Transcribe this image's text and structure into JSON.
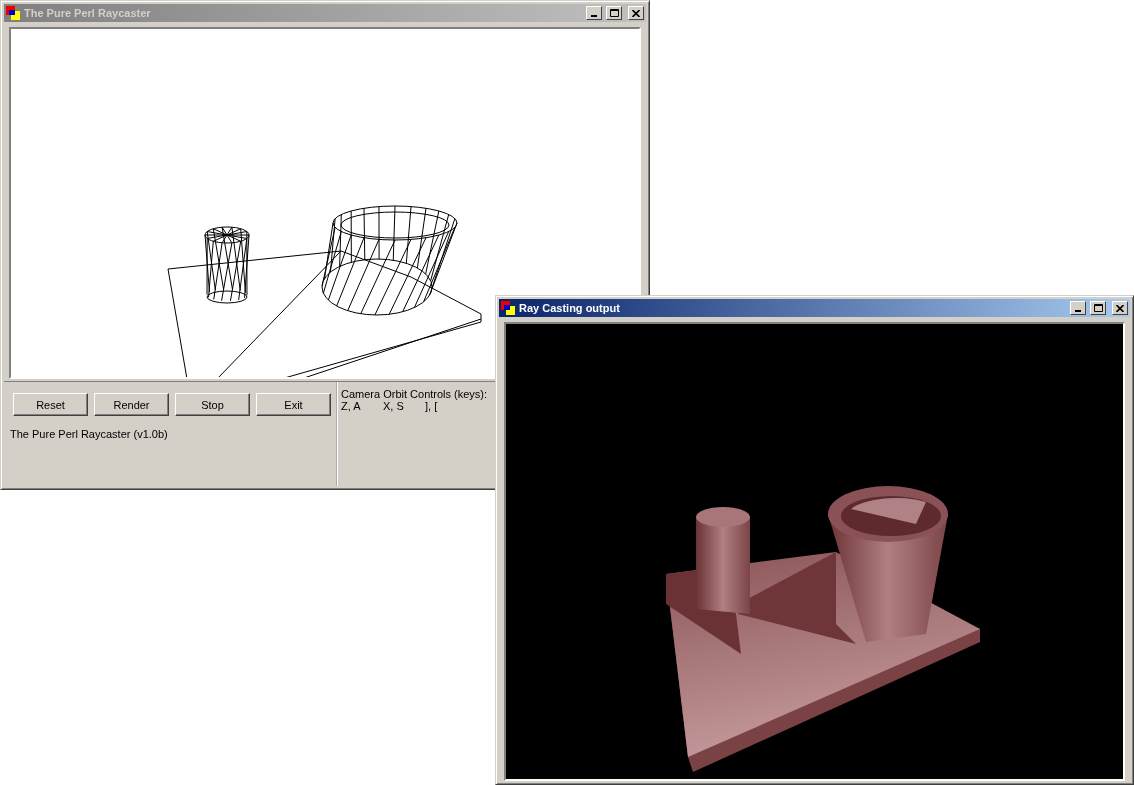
{
  "windows": [
    {
      "title": "The Pure Perl Raycaster",
      "active": false,
      "kind": "editor",
      "buttons": [
        "Reset",
        "Render",
        "Stop",
        "Exit"
      ],
      "status": "The Pure Perl Raycaster (v1.0b)",
      "controls_heading": "Camera Orbit Controls (keys):",
      "keys": [
        "Z, A",
        "X, S",
        "], ["
      ]
    },
    {
      "title": "Ray Casting output",
      "active": true,
      "kind": "output"
    }
  ]
}
